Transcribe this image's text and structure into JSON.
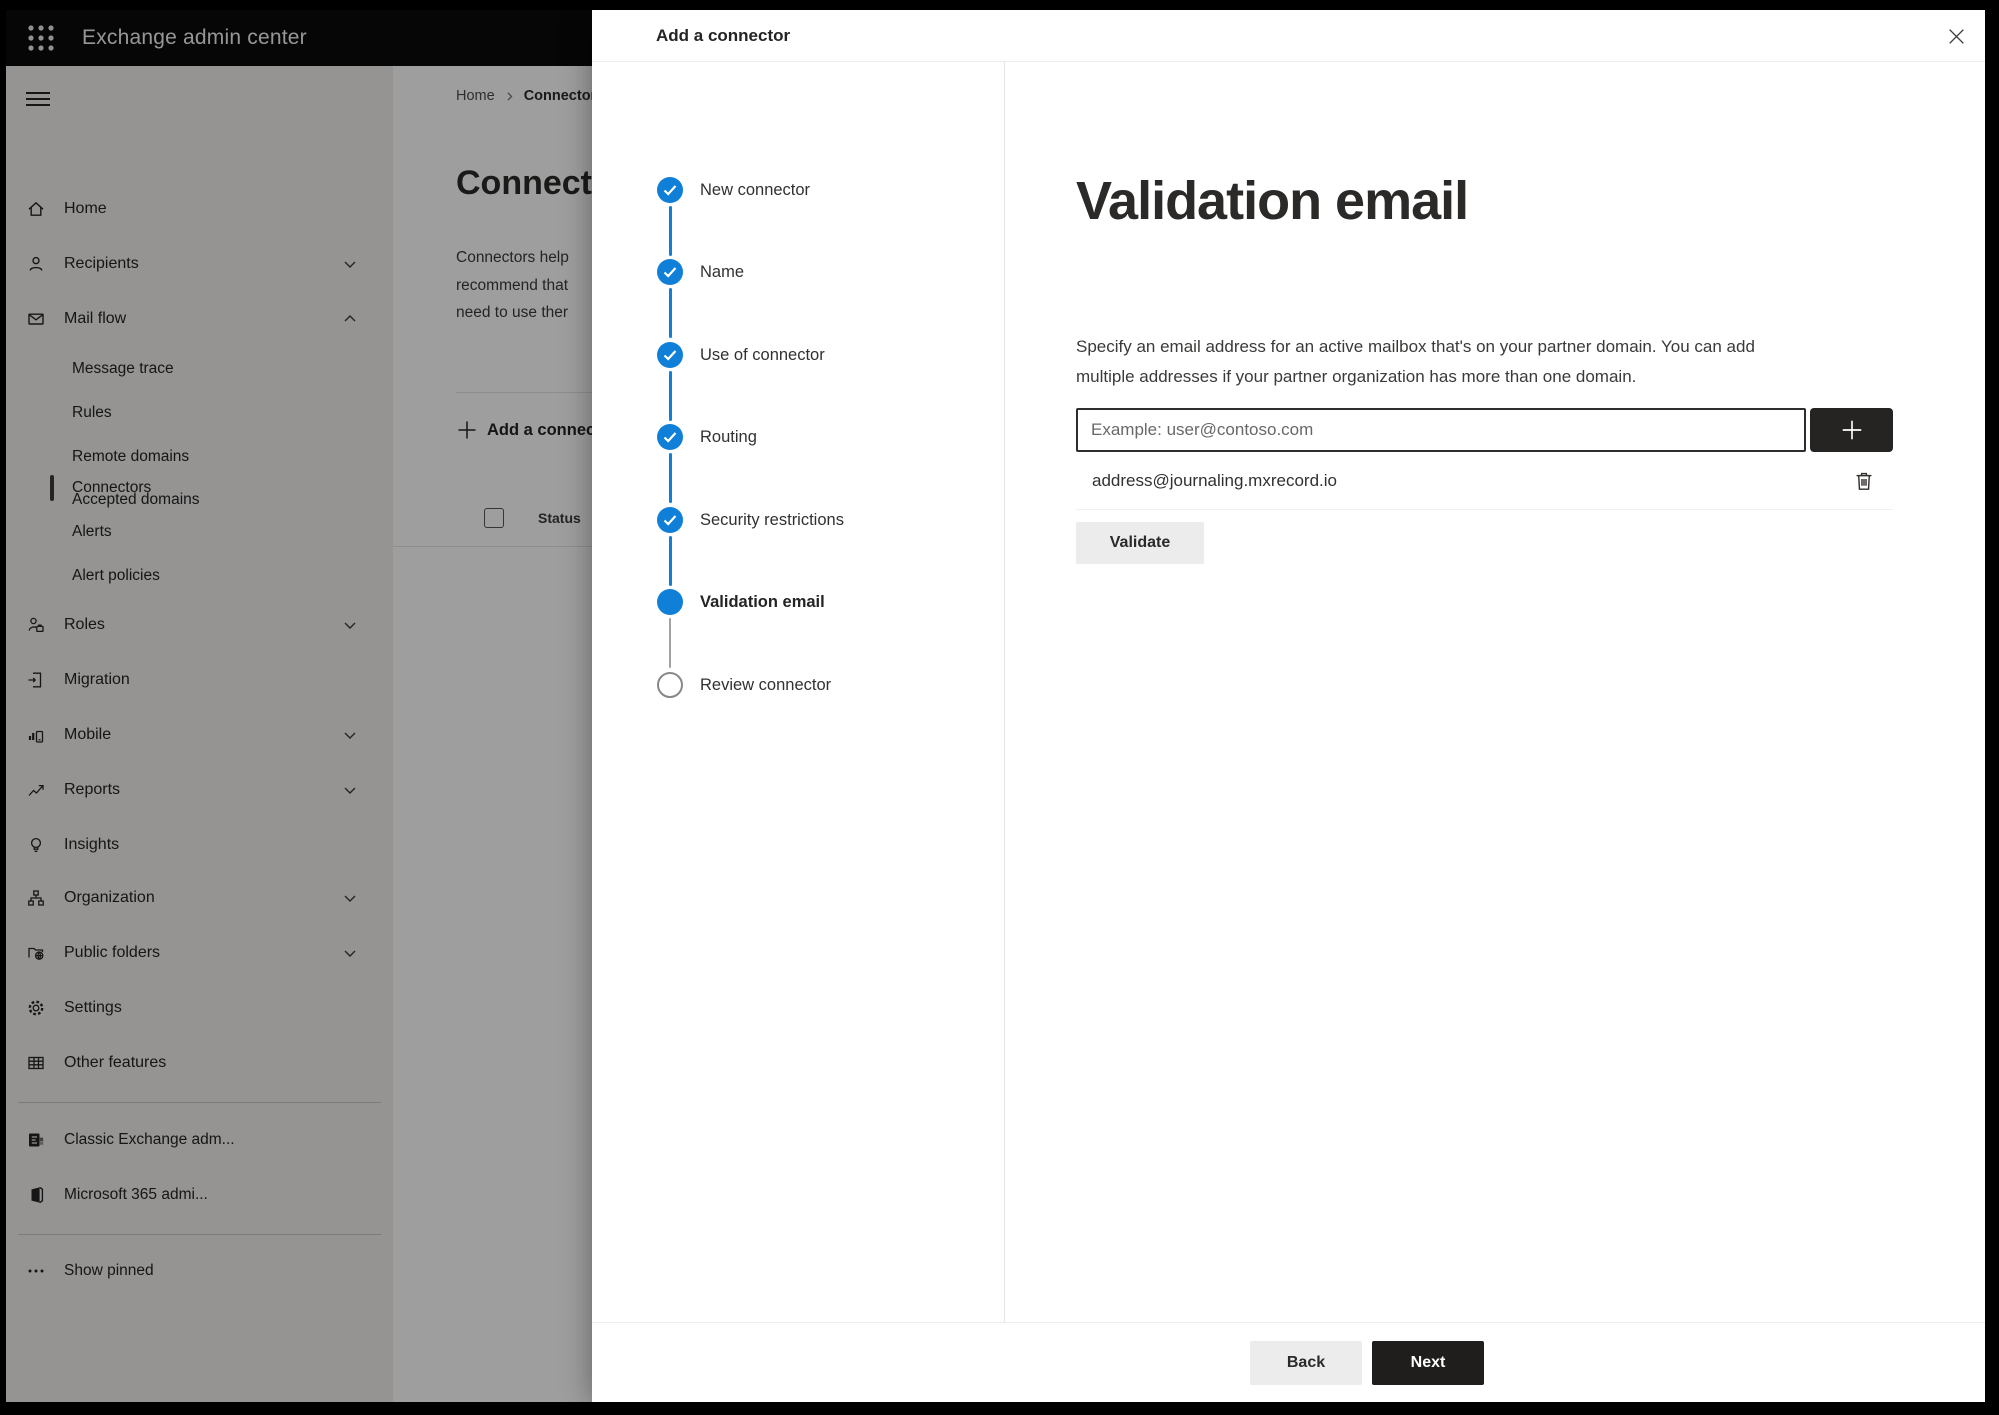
{
  "topbar": {
    "title": "Exchange admin center"
  },
  "sidebar": {
    "nav_top": [
      {
        "label": "Home"
      },
      {
        "label": "Recipients"
      },
      {
        "label": "Mail flow"
      }
    ],
    "nav_sub": [
      "Message trace",
      "Rules",
      "Remote domains",
      "Accepted domains",
      "Connectors",
      "Alerts",
      "Alert policies"
    ],
    "selected_item": "Connectors",
    "nav_mid": [
      "Roles",
      "Migration",
      "Mobile",
      "Reports",
      "Insights",
      "Organization",
      "Public folders",
      "Settings",
      "Other features"
    ],
    "nav_bottom": [
      "Classic Exchange adm...",
      "Microsoft 365 admi..."
    ],
    "show_pinned": "Show pinned"
  },
  "page": {
    "breadcrumb": {
      "home": "Home",
      "current": "Connectors"
    },
    "title": "Connectors",
    "intro_line1": "Connectors help",
    "intro_line2": "recommend that",
    "intro_line3": "need to use ther",
    "add_button": "Add a connector",
    "status_header": "Status"
  },
  "dialog": {
    "title": "Add a connector",
    "steps": [
      {
        "label": "New connector",
        "state": "complete"
      },
      {
        "label": "Name",
        "state": "complete"
      },
      {
        "label": "Use of connector",
        "state": "complete"
      },
      {
        "label": "Routing",
        "state": "complete"
      },
      {
        "label": "Security restrictions",
        "state": "complete"
      },
      {
        "label": "Validation email",
        "state": "active"
      },
      {
        "label": "Review connector",
        "state": "upcoming"
      }
    ],
    "content": {
      "heading": "Validation email",
      "description_line1": "Specify an email address for an active mailbox that's on your partner domain. You can add",
      "description_line2": "multiple addresses if your partner organization has more than one domain.",
      "email_placeholder": "Example: user@contoso.com",
      "address": "address@journaling.mxrecord.io",
      "validate_label": "Validate"
    },
    "footer": {
      "back": "Back",
      "next": "Next"
    }
  },
  "colors": {
    "accent": "#0f7fd7",
    "primary_button": "#1f1e1c",
    "step_upcoming": "#8a8886"
  }
}
